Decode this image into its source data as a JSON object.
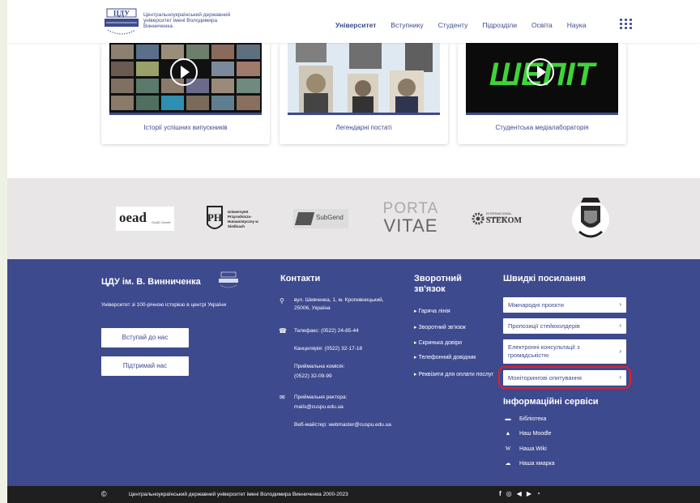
{
  "header": {
    "logo_text": "ЦДУ",
    "university_name": "Центральноукраїнський державний університет імені Володимира Винниченка",
    "nav": [
      {
        "label": "Університет"
      },
      {
        "label": "Вступнику"
      },
      {
        "label": "Студенту"
      },
      {
        "label": "Підрозділи"
      },
      {
        "label": "Освіта"
      },
      {
        "label": "Наука"
      }
    ]
  },
  "cards": [
    {
      "caption": "Історії успішних випускників"
    },
    {
      "caption": "Легендарні постаті"
    },
    {
      "caption": "Студентська медіалабораторія",
      "overlay_text": "ШЕПІТ"
    }
  ],
  "partners": {
    "oead": "oead",
    "oead_sub": "GoAD GmbH",
    "subgend": "SubGend",
    "porta": "PORTA",
    "vitae": "VITAE",
    "stekom": "STEKOM",
    "stekom_top": "INTERNATIONAL UNIVERSITAS",
    "ph_text": "Uniwersytet Przyrodniczo-Humanistyczny w Siedlcach"
  },
  "footer": {
    "brand": "ЦДУ ім. В. Винниченка",
    "tagline": "Університет зі 100-річною історією в центрі України",
    "join_button": "Вступай до нас",
    "support_button": "Підтримай нас",
    "contacts": {
      "title": "Контакти",
      "address": "вул. Шевченка, 1, м. Кропивницький, 25006, Україна",
      "phone": "Телефакс: (0522) 24-85-44",
      "office": "Канцелярія: (0522) 32-17-18",
      "admission_label": "Приймальна комісія:",
      "admission_phone": "(0522) 32-09-99",
      "rector_label": "Приймальня ректора:",
      "rector_email": "mails@cuspu.edu.ua",
      "webmaster": "Веб-майстер: webmaster@cuspu.edu.ua"
    },
    "feedback": {
      "title_line1": "Зворотний",
      "title_line2": "зв'язок",
      "items": [
        {
          "label": "Гаряча лінія"
        },
        {
          "label": "Зворотний зв'язок"
        },
        {
          "label": "Скринька довіри"
        },
        {
          "label": "Телефонний довідник"
        },
        {
          "label": "Реквізити для оплати послуг"
        }
      ]
    },
    "quick_links": {
      "title": "Швидкі посилання",
      "items": [
        {
          "label": "Міжнародні проєкти"
        },
        {
          "label": "Пропозиції стейкхолдерів"
        },
        {
          "label": "Електронні консультації з громадськістю"
        },
        {
          "label": "Моніторингові опитування"
        }
      ],
      "highlight_color": "#e0202a"
    },
    "info_services": {
      "title": "Інформаційні сервіси",
      "items": [
        {
          "label": "Бібліотека",
          "icon": "book-icon"
        },
        {
          "label": "Наш Moodle",
          "icon": "graduation-cap-icon"
        },
        {
          "label": "Наша Wiki",
          "icon": "wikipedia-icon"
        },
        {
          "label": "Наша хмарка",
          "icon": "cloud-icon"
        }
      ]
    }
  },
  "bottom_bar": {
    "copyright_symbol": "©",
    "copyright_text": "Центральноукраїнський державний університет імені Володимира Винниченка 2000-2023",
    "social_icons": [
      "facebook-icon",
      "instagram-icon",
      "telegram-icon",
      "youtube-icon",
      "rss-icon"
    ]
  },
  "colors": {
    "primary": "#3d4a8e",
    "footer_bg": "#3d4a8e",
    "partners_bg": "#e8e6e6",
    "bottom_bg": "#1f1f1f",
    "highlight": "#e0202a"
  }
}
